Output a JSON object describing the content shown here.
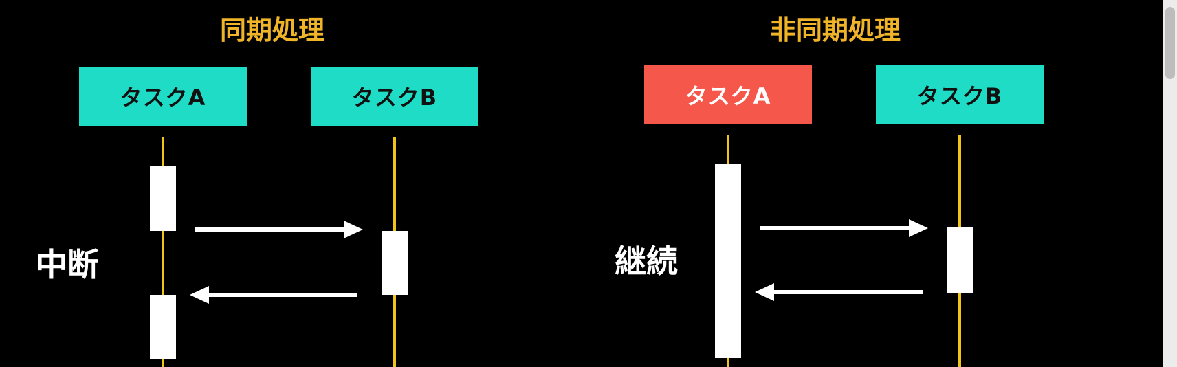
{
  "sync": {
    "title": "同期処理",
    "task_a": "タスクA",
    "task_b": "タスクB",
    "label": "中断"
  },
  "async": {
    "title": "非同期処理",
    "task_a": "タスクA",
    "task_b": "タスクB",
    "label": "継続"
  },
  "colors": {
    "title": "#f0b429",
    "task_box": "#1fdcc6",
    "task_box_highlight": "#f5574a",
    "lifeline": "#f0c419",
    "activation": "#ffffff",
    "arrow": "#ffffff",
    "background": "#000000"
  }
}
